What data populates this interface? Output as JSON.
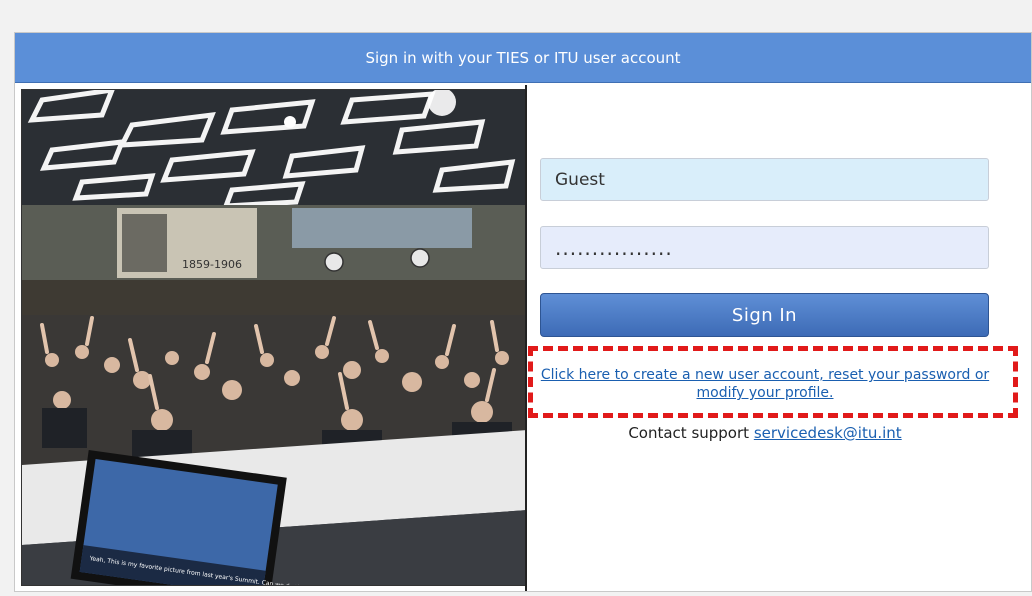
{
  "header": {
    "title": "Sign in with your TIES or ITU user account"
  },
  "photo": {
    "banner_year": "1859-1906",
    "screen_caption": "Yeah, This is my favorite picture from last year's Summit. Can we do the same again this year."
  },
  "form": {
    "username_value": "Guest",
    "password_value": "................",
    "signin_label": "Sign In"
  },
  "links": {
    "create_account": "Click here to create a new user account, reset your password or modify your profile.",
    "contact_prefix": "Contact support",
    "contact_email": "servicedesk@itu.int"
  },
  "colors": {
    "header_bg": "#5b8fd8",
    "button_bg": "#4a77c2",
    "username_bg": "#d9eefa",
    "password_bg": "#e6ecfb",
    "highlight_border": "#e11a1a",
    "link": "#1a5fb0"
  }
}
